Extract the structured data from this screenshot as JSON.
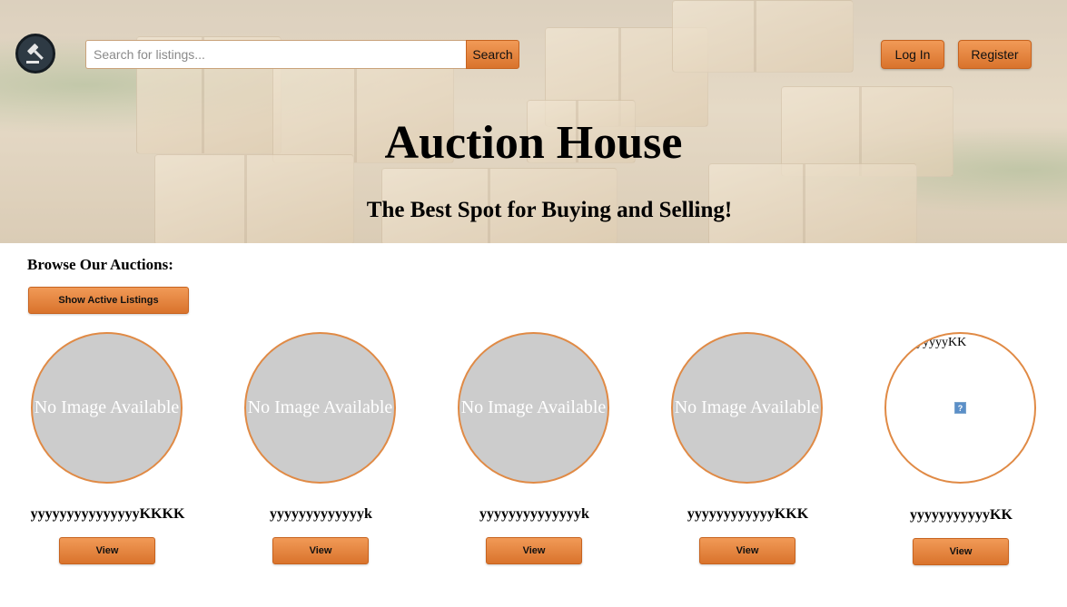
{
  "header": {
    "logo_icon": "gavel-icon",
    "search": {
      "placeholder": "Search for listings...",
      "value": "",
      "button_label": "Search"
    },
    "login_label": "Log In",
    "register_label": "Register"
  },
  "hero": {
    "title": "Auction House",
    "subtitle": "The Best Spot for Buying and Selling!"
  },
  "browse": {
    "heading": "Browse Our Auctions:",
    "active_button_label": "Show Active Listings"
  },
  "listings": [
    {
      "image_text": "No Image Available",
      "title": "yyyyyyyyyyyyyyyKKKK",
      "view_label": "View"
    },
    {
      "image_text": "No Image Available",
      "title": "yyyyyyyyyyyyyk",
      "view_label": "View"
    },
    {
      "image_text": "No Image Available",
      "title": "yyyyyyyyyyyyyyk",
      "view_label": "View"
    },
    {
      "image_text": "No Image Available",
      "title": "yyyyyyyyyyyyKKK",
      "view_label": "View"
    },
    {
      "image_alt": "yyyyyKK",
      "broken_image_icon": "broken-image-icon",
      "title": "yyyyyyyyyyyKK",
      "view_label": "View"
    }
  ],
  "colors": {
    "accent": "#e8823d",
    "accent_border": "#c7631f",
    "placeholder_circle": "#cccccc"
  }
}
